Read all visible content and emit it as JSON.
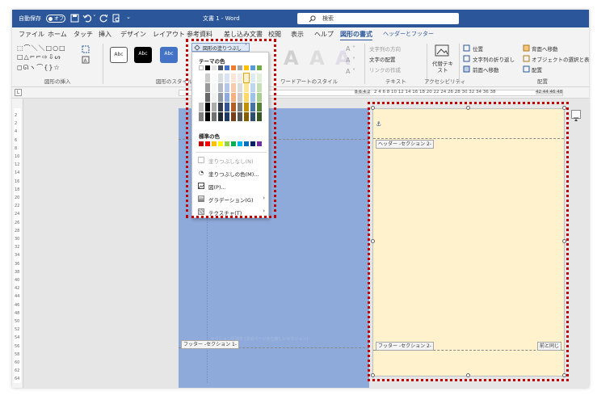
{
  "titlebar": {
    "autosave_label": "自動保存",
    "autosave_state": "オフ",
    "doc_title": "文書 1 - Word",
    "search_placeholder": "検索"
  },
  "tabs": [
    {
      "label": "ファイル"
    },
    {
      "label": "ホーム"
    },
    {
      "label": "タッチ"
    },
    {
      "label": "挿入"
    },
    {
      "label": "デザイン"
    },
    {
      "label": "レイアウト"
    },
    {
      "label": "参考資料"
    },
    {
      "label": "差し込み文書"
    },
    {
      "label": "校閲"
    },
    {
      "label": "表示"
    },
    {
      "label": "ヘルプ"
    },
    {
      "label": "図形の書式",
      "active": true
    },
    {
      "label": "ヘッダーとフッター"
    }
  ],
  "ribbon": {
    "shape_insert_label": "図形の挿入",
    "shape_style_label": "図形のスタイル",
    "style_sample": "Abc",
    "fill_button": "図形の塗りつぶし",
    "wordart_label": "ワードアートのスタイル",
    "wordart_sample": "A",
    "text_direction": "文字列の方向",
    "text_align": "文字の配置",
    "link_create": "リンクの作成",
    "text_group": "テキスト",
    "alt_text": "代替テキスト",
    "accessibility": "アクセシビリティ",
    "position": "位置",
    "wrap_text": "文字列の折り返し",
    "bring_forward": "前面へ移動",
    "send_backward": "背面へ移動",
    "selection_pane": "オブジェクトの選択と表示",
    "align": "配置",
    "arrange_group": "配置"
  },
  "ruler": {
    "left_numbers": "8 6 4 2",
    "right_numbers": "2 4 6 8 10 12 14 16 18 20 22 24 26 28 30 32 34 36 38",
    "far_right_numbers": "42 44 46 48",
    "vertical_numbers": [
      "2",
      "2",
      "4",
      "6",
      "8",
      "10",
      "12",
      "14",
      "16",
      "18",
      "20",
      "22",
      "24",
      "26",
      "28",
      "30",
      "32",
      "34",
      "36",
      "38",
      "40",
      "42",
      "44",
      "46",
      "48",
      "50",
      "52",
      "54",
      "56",
      "58",
      "60",
      "62",
      "64"
    ]
  },
  "dropdown": {
    "theme_colors_title": "テーマの色",
    "standard_colors_title": "標準の色",
    "items": [
      {
        "label": "塗りつぶしなし(N)",
        "icon": "no-fill-icon",
        "disabled": true
      },
      {
        "label": "塗りつぶしの色(M)...",
        "icon": "color-palette-icon"
      },
      {
        "label": "図(P)...",
        "icon": "picture-icon"
      },
      {
        "label": "グラデーション(G)",
        "icon": "gradient-icon",
        "submenu": true
      },
      {
        "label": "テクスチャ(T)",
        "icon": "texture-icon",
        "submenu": true
      }
    ],
    "theme_row": [
      "#ffffff",
      "#000000",
      "#e7e6e6",
      "#44546a",
      "#4472c4",
      "#ed7d31",
      "#a5a5a5",
      "#ffc000",
      "#5b9bd5",
      "#70ad47"
    ],
    "standard_row": [
      "#c00000",
      "#ff0000",
      "#ffc000",
      "#ffff00",
      "#92d050",
      "#00b050",
      "#00b0f0",
      "#0070c0",
      "#002060",
      "#7030a0"
    ]
  },
  "document": {
    "header_tag": "ヘッダー -セクション 2-",
    "footer_tag_left": "フッター -セクション 1-",
    "footer_tag_right": "フッター -セクション 2-",
    "same_as_previous": "前と同じ",
    "section_break_label": "セクション区切り (次のページから新しいセクション)",
    "left_page_color": "#8eaadb",
    "right_page_color": "#fff2cc"
  }
}
